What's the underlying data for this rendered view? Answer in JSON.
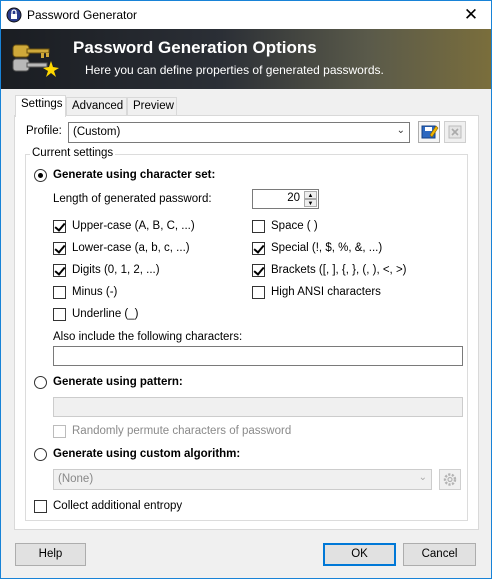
{
  "window": {
    "title": "Password Generator",
    "close_glyph": "✕",
    "icon": "password-generator-icon"
  },
  "banner": {
    "title": "Password Generation Options",
    "subtitle": "Here you can define properties of generated passwords.",
    "icon": "keys-icon"
  },
  "tabs": [
    {
      "label": "Settings",
      "active": true
    },
    {
      "label": "Advanced",
      "active": false
    },
    {
      "label": "Preview",
      "active": false
    }
  ],
  "profile": {
    "label": "Profile:",
    "value": "(Custom)",
    "save_icon": "save-profile-icon",
    "delete_icon": "delete-profile-icon"
  },
  "current_settings": {
    "title": "Current settings",
    "charset": {
      "label": "Generate using character set:",
      "selected": true,
      "length_label": "Length of generated password:",
      "length_value": "20",
      "options": [
        {
          "label": "Upper-case (A, B, C, ...)",
          "checked": true
        },
        {
          "label": "Lower-case (a, b, c, ...)",
          "checked": true
        },
        {
          "label": "Digits (0, 1, 2, ...)",
          "checked": true
        },
        {
          "label": "Minus (-)",
          "checked": false
        },
        {
          "label": "Underline (_)",
          "checked": false
        },
        {
          "label": "Space ( )",
          "checked": false
        },
        {
          "label": "Special (!, $, %, &, ...)",
          "checked": true
        },
        {
          "label": "Brackets ([, ], {, }, (, ), <, >)",
          "checked": true
        },
        {
          "label": "High ANSI characters",
          "checked": false
        }
      ],
      "include_label": "Also include the following characters:",
      "include_value": ""
    },
    "pattern": {
      "label": "Generate using pattern:",
      "selected": false,
      "value": "",
      "permute_label": "Randomly permute characters of password",
      "permute_checked": false
    },
    "custom": {
      "label": "Generate using custom algorithm:",
      "selected": false,
      "value": "(None)",
      "settings_icon": "gear-icon"
    },
    "entropy": {
      "label": "Collect additional entropy",
      "checked": false
    }
  },
  "buttons": {
    "help": "Help",
    "ok": "OK",
    "cancel": "Cancel"
  },
  "colors": {
    "accent": "#0078d7",
    "banner_dark": "#1a1d22"
  }
}
